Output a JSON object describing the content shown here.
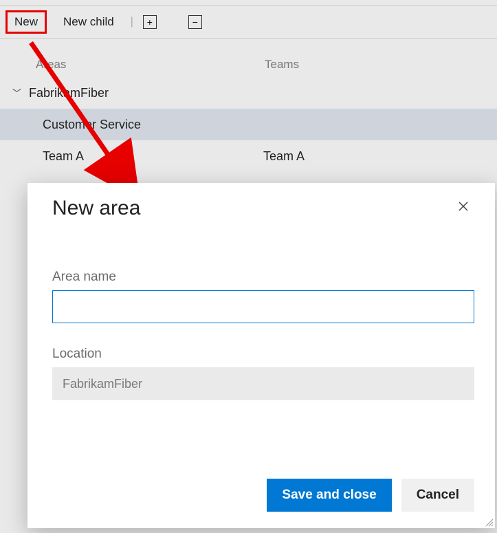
{
  "toolbar": {
    "new_label": "New",
    "new_child_label": "New child",
    "expand_label": "+",
    "collapse_label": "−"
  },
  "columns": {
    "areas": "Areas",
    "teams": "Teams"
  },
  "tree": {
    "root_label": "FabrikamFiber",
    "items": [
      {
        "label": "Customer Service",
        "team": ""
      },
      {
        "label": "Team A",
        "team": "Team A"
      }
    ]
  },
  "dialog": {
    "title": "New area",
    "area_name_label": "Area name",
    "area_name_value": "",
    "location_label": "Location",
    "location_value": "FabrikamFiber",
    "save_label": "Save and close",
    "cancel_label": "Cancel"
  }
}
